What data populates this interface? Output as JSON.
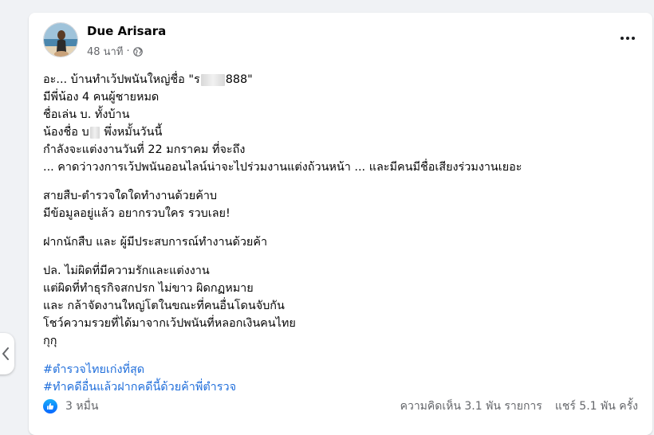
{
  "post": {
    "author": "Due Arisara",
    "time": "48 นาที",
    "separator": "·",
    "privacy_icon": "globe-icon",
    "lines": {
      "l1a": "อะ... บ้านทำเว้ปพนันใหญ่ชื่อ \"ร",
      "l1b": "888\"",
      "l2": "มีพี่น้อง 4 คนผู้ชายหมด",
      "l3": "ชื่อเล่น บ. ทั้งบ้าน",
      "l4a": "น้องชื่อ บ",
      "l4b": " พึ่งหมั้นวันนี้",
      "l5": "กำลังจะแต่งงานวันที่ 22 มกราคม ที่จะถึง",
      "l6": "... คาดว่าวงการเว้ปพนันออนไลน์น่าจะไปร่วมงานแต่งถ้วนหน้า ... และมีคนมีชื่อเสียงร่วมงานเยอะ",
      "l7": "สายสืบ-ตำรวจใดใดทำงานด้วยค้าบ",
      "l8": "มีข้อมูลอยู่แล้ว อยากรวบใคร รวบเลย!",
      "l9": "ฝากนักสืบ และ ผู้มีประสบการณ์ทำงานด้วยค้า",
      "l10": "ปล. ไม่ผิดที่มีความรักและแต่งงาน",
      "l11": "แต่ผิดที่ทำธุรกิจสกปรก ไม่ขาว ผิดกฏหมาย",
      "l12": "และ กล้าจัดงานใหญ่โตในขณะที่คนอื่นโดนจับกัน",
      "l13": "โชว์ความรวยที่ได้มาจากเว้ปพนันที่หลอกเงินคนไทย",
      "l14": "กุกุ"
    },
    "hashtags": {
      "h1": "#ตำรวจไทยเก่งที่สุด",
      "h2": "#ทำคดีอื่นแล้วฝากคดีนี้ด้วยค้าพี่ตำรวจ"
    },
    "reactions": {
      "icon": "like-icon",
      "count": "3 หมื่น"
    },
    "comments": "ความคิดเห็น 3.1 พัน รายการ",
    "shares": "แชร์ 5.1 พัน ครั้ง"
  },
  "colors": {
    "hashtag": "#216fdb",
    "like": "#0866ff",
    "secondary_text": "#65676b"
  }
}
